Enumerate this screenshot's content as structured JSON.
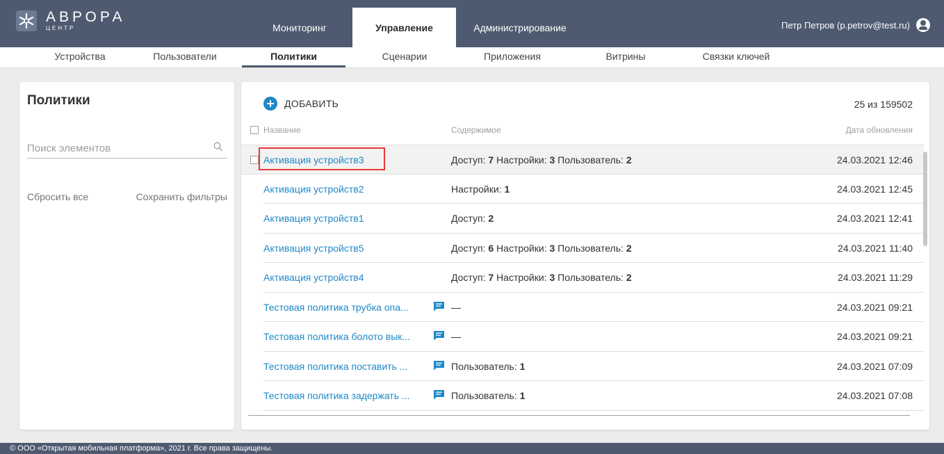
{
  "header": {
    "logo_title": "АВРОРА",
    "logo_subtitle": "ЦЕНТР",
    "nav": [
      {
        "label": "Мониторинг",
        "active": false
      },
      {
        "label": "Управление",
        "active": true
      },
      {
        "label": "Администрирование",
        "active": false
      }
    ],
    "user": "Петр Петров (p.petrov@test.ru)",
    "colors": {
      "bar": "#4d5a70",
      "accent": "#1e88c8",
      "highlight": "#e53935"
    }
  },
  "subnav": [
    {
      "label": "Устройства",
      "active": false
    },
    {
      "label": "Пользователи",
      "active": false
    },
    {
      "label": "Политики",
      "active": true
    },
    {
      "label": "Сценарии",
      "active": false
    },
    {
      "label": "Приложения",
      "active": false
    },
    {
      "label": "Витрины",
      "active": false
    },
    {
      "label": "Связки ключей",
      "active": false
    }
  ],
  "sidebar": {
    "title": "Политики",
    "search_placeholder": "Поиск элементов",
    "reset": "Сбросить все",
    "save": "Сохранить фильтры"
  },
  "list": {
    "add_label": "ДОБАВИТЬ",
    "count": "25 из 159502",
    "columns": {
      "name": "Название",
      "content": "Содержимое",
      "date": "Дата обновления"
    },
    "rows": [
      {
        "name": "Активация устройств3",
        "content": "Доступ: 7  Настройки: 3  Пользователь: 2",
        "date": "24.03.2021 12:46",
        "comment": false
      },
      {
        "name": "Активация устройств2",
        "content": "Настройки: 1",
        "date": "24.03.2021 12:45",
        "comment": false
      },
      {
        "name": "Активация устройств1",
        "content": "Доступ: 2",
        "date": "24.03.2021 12:41",
        "comment": false
      },
      {
        "name": "Активация устройств5",
        "content": "Доступ: 6  Настройки: 3  Пользователь: 2",
        "date": "24.03.2021 11:40",
        "comment": false
      },
      {
        "name": "Активация устройств4",
        "content": "Доступ: 7  Настройки: 3  Пользователь: 2",
        "date": "24.03.2021 11:29",
        "comment": false
      },
      {
        "name": "Тестовая политика трубка опа...",
        "content": "—",
        "date": "24.03.2021 09:21",
        "comment": true
      },
      {
        "name": "Тестовая политика болото вык...",
        "content": "—",
        "date": "24.03.2021 09:21",
        "comment": true
      },
      {
        "name": "Тестовая политика поставить ...",
        "content": "Пользователь: 1",
        "date": "24.03.2021 07:09",
        "comment": true
      },
      {
        "name": "Тестовая политика задержать ...",
        "content": "Пользователь: 1",
        "date": "24.03.2021 07:08",
        "comment": true
      }
    ]
  },
  "footer": "© ООО «Открытая мобильная платформа», 2021 г. Все права защищены."
}
